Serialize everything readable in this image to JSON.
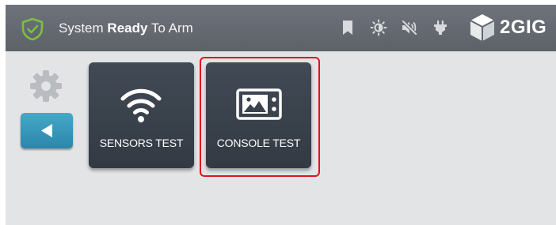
{
  "header": {
    "status_prefix": "System",
    "status_bold": "Ready",
    "status_suffix": "To Arm",
    "brand": "2GIG",
    "icons": [
      "shield-check-icon",
      "bookmark-icon",
      "brightness-icon",
      "mute-icon",
      "power-plug-icon"
    ]
  },
  "sidebar": {
    "settings_icon": "gear-icon",
    "back_icon": "back-arrow-icon"
  },
  "tiles": [
    {
      "label": "SENSORS TEST",
      "icon": "wifi-icon"
    },
    {
      "label": "CONSOLE TEST",
      "icon": "console-screen-icon",
      "highlighted": true
    }
  ],
  "colors": {
    "header": "#62666d",
    "background": "#e3e4e6",
    "tile": "#3a424c",
    "accent_green": "#78c142",
    "back_button": "#3a9bc0",
    "highlight": "#e0141c"
  }
}
